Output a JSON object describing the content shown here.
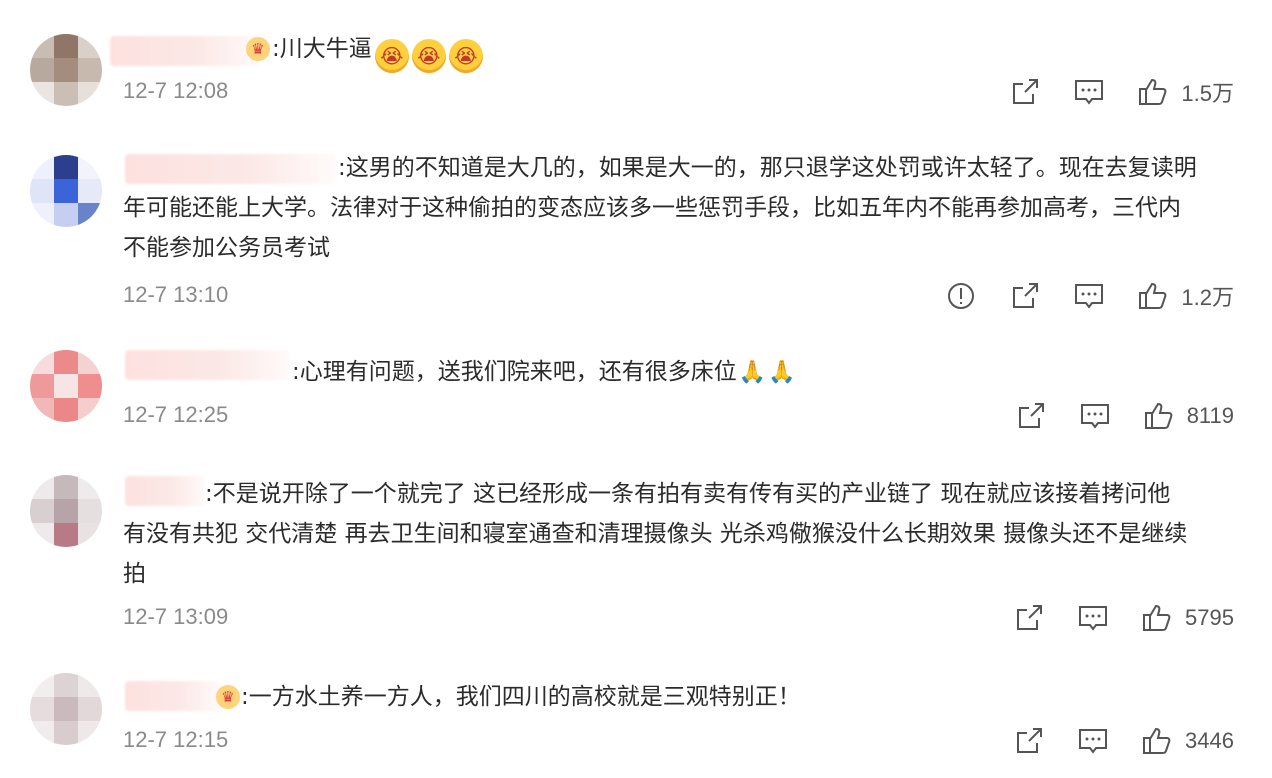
{
  "comments": [
    {
      "text": ":川大牛逼",
      "emojis": [
        "😭",
        "😭",
        "😭"
      ],
      "badge": "crown-badge",
      "time": "12-7 12:08",
      "likes": "1.5万",
      "report": false
    },
    {
      "text_lines": [
        ":这男的不知道是大几的，如果是大一的，那只退学这处罚或许太轻了。现在去复读明",
        "年可能还能上大学。法律对于这种偷拍的变态应该多一些惩罚手段，比如五年内不能再参加高考，三代内",
        "不能参加公务员考试"
      ],
      "time": "12-7 13:10",
      "likes": "1.2万",
      "report": true
    },
    {
      "text": ":心理有问题，送我们院来吧，还有很多床位",
      "emojis": [
        "🙏",
        "🙏"
      ],
      "time": "12-7 12:25",
      "likes": "8119",
      "report": false
    },
    {
      "text_lines": [
        ":不是说开除了一个就完了 这已经形成一条有拍有卖有传有买的产业链了 现在就应该接着拷问他",
        "有没有共犯 交代清楚 再去卫生间和寝室通查和清理摄像头 光杀鸡儆猴没什么长期效果 摄像头还不是继续",
        "拍"
      ],
      "time": "12-7 13:09",
      "likes": "5795",
      "report": false
    },
    {
      "text": ":一方水土养一方人，我们四川的高校就是三观特别正！",
      "badge": "crown-badge",
      "time": "12-7 12:15",
      "likes": "3446",
      "report": false
    }
  ],
  "icons": {
    "report": "exclamation-circle-icon",
    "share": "share-icon",
    "reply": "comment-icon",
    "like": "thumbs-up-icon"
  }
}
